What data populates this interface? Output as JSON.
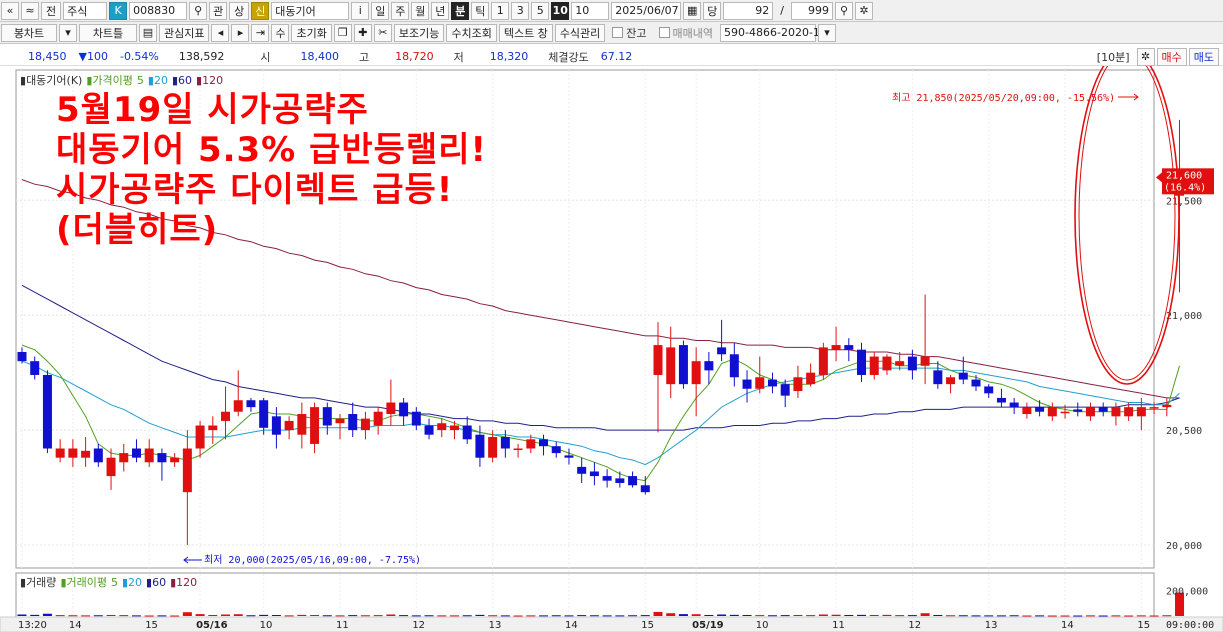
{
  "toolbar1": {
    "btn_prev": "«",
    "btn_up": "≈",
    "btn_jeon": "전",
    "type_select": "주식",
    "k_badge": "K",
    "code": "008830",
    "btn_gwan": "관",
    "btn_sang": "상",
    "sin_badge": "신",
    "name": "대동기어",
    "btn_info": "i",
    "periods": [
      "일",
      "주",
      "월",
      "년",
      "분",
      "틱"
    ],
    "active_period": "분",
    "intervals": [
      "1",
      "3",
      "5",
      "10"
    ],
    "active_interval": "10",
    "interval_select": "10",
    "date": "2025/06/07",
    "btn_dang": "당",
    "count": "92",
    "slash": "/",
    "max": "999"
  },
  "toolbar2": {
    "btn_bongchart": "봉차트",
    "btn_chartteul": "차트틀",
    "btn_gwansim": "관심지표",
    "btn_su": "수",
    "btn_chogihwa": "초기화",
    "btn_bojo": "보조기능",
    "btn_suchi": "수치조회",
    "btn_text": "텍스트 창",
    "btn_susik": "수식관리",
    "chk_jango": "잔고",
    "chk_maemae": "매매내역",
    "account": "590-4866-2020-1"
  },
  "quote": {
    "price": "18,450",
    "change": "▼100",
    "change_pct": "-0.54%",
    "volume": "138,592",
    "open_label": "시",
    "open": "18,400",
    "high_label": "고",
    "high": "18,720",
    "low_label": "저",
    "low": "18,320",
    "strength_label": "체결강도",
    "strength": "67.12",
    "btn_10bun": "[10분]",
    "btn_maesu": "매수",
    "btn_maedo": "매도"
  },
  "overlay": {
    "line1": "5월19일 시가공략주",
    "line2": "대동기어 5.3% 급반등랠리!",
    "line3": "시가공략주 다이렉트 급등!",
    "line4": "(더블히트)"
  },
  "chart_data": {
    "type": "candlestick",
    "legend_price": {
      "name": "대동기어(K)",
      "ma_label": "가격이평",
      "ma_periods": [
        "5",
        "20",
        "60",
        "120"
      ]
    },
    "legend_volume": {
      "name": "거래량",
      "ma_label": "거래이평",
      "ma_periods": [
        "5",
        "20",
        "60",
        "120"
      ]
    },
    "ylim": [
      19900,
      21980
    ],
    "yticks": [
      "21,500",
      "21,000",
      "20,500",
      "20,000"
    ],
    "ytick_values": [
      21500,
      21000,
      20500,
      20000
    ],
    "vol_ylim": [
      0,
      300000
    ],
    "vol_tick": "200,000",
    "vol_tick_value": 200000,
    "xticks": [
      {
        "i": 0,
        "label": "13:20"
      },
      {
        "i": 4,
        "label": "14"
      },
      {
        "i": 10,
        "label": "15"
      },
      {
        "i": 14,
        "label": "05/16"
      },
      {
        "i": 19,
        "label": "10"
      },
      {
        "i": 25,
        "label": "11"
      },
      {
        "i": 31,
        "label": "12"
      },
      {
        "i": 37,
        "label": "13"
      },
      {
        "i": 43,
        "label": "14"
      },
      {
        "i": 49,
        "label": "15"
      },
      {
        "i": 53,
        "label": "05/19"
      },
      {
        "i": 58,
        "label": "10"
      },
      {
        "i": 64,
        "label": "11"
      },
      {
        "i": 70,
        "label": "12"
      },
      {
        "i": 76,
        "label": "13"
      },
      {
        "i": 82,
        "label": "14"
      },
      {
        "i": 88,
        "label": "15"
      }
    ],
    "time_label": "09:00:00",
    "high_annotation": "최고 21,850(2025/05/20,09:00, -15.56%)",
    "low_annotation": "최저 20,000(2025/05/16,09:00, -7.75%)",
    "last_price_label": "21,600",
    "last_pct_label": "(16.4%)",
    "last_price": 21600,
    "colors": {
      "up": "#e01010",
      "down": "#1010d0",
      "ma5": "#50a020",
      "ma20": "#20a0d0",
      "ma60": "#20208a",
      "ma120": "#8a2040"
    },
    "candles": [
      {
        "o": 20840,
        "h": 20860,
        "l": 20790,
        "c": 20800,
        "v": 12000
      },
      {
        "o": 20800,
        "h": 20820,
        "l": 20720,
        "c": 20740,
        "v": 9000
      },
      {
        "o": 20740,
        "h": 20760,
        "l": 20400,
        "c": 20420,
        "v": 18000
      },
      {
        "o": 20380,
        "h": 20460,
        "l": 20360,
        "c": 20420,
        "v": 7000
      },
      {
        "o": 20380,
        "h": 20460,
        "l": 20340,
        "c": 20420,
        "v": 6000
      },
      {
        "o": 20380,
        "h": 20470,
        "l": 20340,
        "c": 20410,
        "v": 5000
      },
      {
        "o": 20420,
        "h": 20440,
        "l": 20340,
        "c": 20360,
        "v": 6000
      },
      {
        "o": 20300,
        "h": 20420,
        "l": 20240,
        "c": 20380,
        "v": 8000
      },
      {
        "o": 20360,
        "h": 20440,
        "l": 20320,
        "c": 20400,
        "v": 7000
      },
      {
        "o": 20420,
        "h": 20460,
        "l": 20360,
        "c": 20380,
        "v": 5000
      },
      {
        "o": 20360,
        "h": 20460,
        "l": 20340,
        "c": 20420,
        "v": 4000
      },
      {
        "o": 20400,
        "h": 20420,
        "l": 20280,
        "c": 20360,
        "v": 5000
      },
      {
        "o": 20360,
        "h": 20400,
        "l": 20340,
        "c": 20380,
        "v": 4000
      },
      {
        "o": 20230,
        "h": 20500,
        "l": 20000,
        "c": 20420,
        "v": 30000
      },
      {
        "o": 20420,
        "h": 20540,
        "l": 20380,
        "c": 20520,
        "v": 15000
      },
      {
        "o": 20500,
        "h": 20560,
        "l": 20440,
        "c": 20520,
        "v": 8000
      },
      {
        "o": 20540,
        "h": 20690,
        "l": 20460,
        "c": 20580,
        "v": 12000
      },
      {
        "o": 20580,
        "h": 20760,
        "l": 20560,
        "c": 20630,
        "v": 14000
      },
      {
        "o": 20630,
        "h": 20640,
        "l": 20580,
        "c": 20600,
        "v": 6000
      },
      {
        "o": 20630,
        "h": 20640,
        "l": 20480,
        "c": 20510,
        "v": 9000
      },
      {
        "o": 20560,
        "h": 20600,
        "l": 20420,
        "c": 20480,
        "v": 8000
      },
      {
        "o": 20500,
        "h": 20560,
        "l": 20460,
        "c": 20540,
        "v": 5000
      },
      {
        "o": 20480,
        "h": 20620,
        "l": 20420,
        "c": 20570,
        "v": 9000
      },
      {
        "o": 20440,
        "h": 20620,
        "l": 20400,
        "c": 20600,
        "v": 8000
      },
      {
        "o": 20600,
        "h": 20620,
        "l": 20480,
        "c": 20520,
        "v": 6000
      },
      {
        "o": 20530,
        "h": 20570,
        "l": 20460,
        "c": 20550,
        "v": 5000
      },
      {
        "o": 20570,
        "h": 20620,
        "l": 20470,
        "c": 20500,
        "v": 7000
      },
      {
        "o": 20500,
        "h": 20580,
        "l": 20460,
        "c": 20550,
        "v": 6000
      },
      {
        "o": 20520,
        "h": 20600,
        "l": 20480,
        "c": 20580,
        "v": 7000
      },
      {
        "o": 20570,
        "h": 20720,
        "l": 20520,
        "c": 20620,
        "v": 12000
      },
      {
        "o": 20620,
        "h": 20640,
        "l": 20520,
        "c": 20560,
        "v": 7000
      },
      {
        "o": 20580,
        "h": 20600,
        "l": 20500,
        "c": 20520,
        "v": 5000
      },
      {
        "o": 20520,
        "h": 20550,
        "l": 20460,
        "c": 20480,
        "v": 6000
      },
      {
        "o": 20500,
        "h": 20550,
        "l": 20470,
        "c": 20530,
        "v": 5000
      },
      {
        "o": 20500,
        "h": 20540,
        "l": 20460,
        "c": 20520,
        "v": 5000
      },
      {
        "o": 20520,
        "h": 20560,
        "l": 20440,
        "c": 20460,
        "v": 6000
      },
      {
        "o": 20480,
        "h": 20520,
        "l": 20340,
        "c": 20380,
        "v": 9000
      },
      {
        "o": 20380,
        "h": 20500,
        "l": 20360,
        "c": 20470,
        "v": 6000
      },
      {
        "o": 20470,
        "h": 20500,
        "l": 20380,
        "c": 20420,
        "v": 5000
      },
      {
        "o": 20420,
        "h": 20440,
        "l": 20380,
        "c": 20420,
        "v": 4000
      },
      {
        "o": 20420,
        "h": 20480,
        "l": 20400,
        "c": 20460,
        "v": 5000
      },
      {
        "o": 20460,
        "h": 20480,
        "l": 20390,
        "c": 20430,
        "v": 5000
      },
      {
        "o": 20430,
        "h": 20450,
        "l": 20380,
        "c": 20400,
        "v": 6000
      },
      {
        "o": 20390,
        "h": 20420,
        "l": 20350,
        "c": 20380,
        "v": 5000
      },
      {
        "o": 20340,
        "h": 20380,
        "l": 20270,
        "c": 20310,
        "v": 7000
      },
      {
        "o": 20320,
        "h": 20360,
        "l": 20260,
        "c": 20300,
        "v": 6000
      },
      {
        "o": 20300,
        "h": 20330,
        "l": 20250,
        "c": 20280,
        "v": 5000
      },
      {
        "o": 20290,
        "h": 20320,
        "l": 20250,
        "c": 20270,
        "v": 5000
      },
      {
        "o": 20300,
        "h": 20320,
        "l": 20250,
        "c": 20260,
        "v": 6000
      },
      {
        "o": 20260,
        "h": 20300,
        "l": 20220,
        "c": 20230,
        "v": 7000
      },
      {
        "o": 20740,
        "h": 20970,
        "l": 20490,
        "c": 20870,
        "v": 32000
      },
      {
        "o": 20700,
        "h": 20950,
        "l": 20640,
        "c": 20860,
        "v": 22000
      },
      {
        "o": 20870,
        "h": 20890,
        "l": 20680,
        "c": 20700,
        "v": 15000
      },
      {
        "o": 20700,
        "h": 20860,
        "l": 20560,
        "c": 20800,
        "v": 14000
      },
      {
        "o": 20800,
        "h": 20840,
        "l": 20700,
        "c": 20760,
        "v": 8000
      },
      {
        "o": 20860,
        "h": 20980,
        "l": 20800,
        "c": 20830,
        "v": 12000
      },
      {
        "o": 20830,
        "h": 20880,
        "l": 20690,
        "c": 20730,
        "v": 9000
      },
      {
        "o": 20720,
        "h": 20760,
        "l": 20620,
        "c": 20680,
        "v": 8000
      },
      {
        "o": 20680,
        "h": 20820,
        "l": 20660,
        "c": 20730,
        "v": 7000
      },
      {
        "o": 20720,
        "h": 20750,
        "l": 20660,
        "c": 20690,
        "v": 6000
      },
      {
        "o": 20700,
        "h": 20720,
        "l": 20600,
        "c": 20650,
        "v": 7000
      },
      {
        "o": 20670,
        "h": 20780,
        "l": 20640,
        "c": 20730,
        "v": 8000
      },
      {
        "o": 20700,
        "h": 20790,
        "l": 20690,
        "c": 20750,
        "v": 7000
      },
      {
        "o": 20740,
        "h": 20880,
        "l": 20720,
        "c": 20860,
        "v": 12000
      },
      {
        "o": 20850,
        "h": 20950,
        "l": 20800,
        "c": 20870,
        "v": 10000
      },
      {
        "o": 20870,
        "h": 20900,
        "l": 20800,
        "c": 20850,
        "v": 8000
      },
      {
        "o": 20850,
        "h": 20880,
        "l": 20710,
        "c": 20740,
        "v": 9000
      },
      {
        "o": 20740,
        "h": 20840,
        "l": 20720,
        "c": 20820,
        "v": 8000
      },
      {
        "o": 20760,
        "h": 20830,
        "l": 20740,
        "c": 20820,
        "v": 9000
      },
      {
        "o": 20780,
        "h": 20840,
        "l": 20760,
        "c": 20800,
        "v": 7000
      },
      {
        "o": 20820,
        "h": 20850,
        "l": 20720,
        "c": 20760,
        "v": 7000
      },
      {
        "o": 20780,
        "h": 21090,
        "l": 20700,
        "c": 20820,
        "v": 22000
      },
      {
        "o": 20760,
        "h": 20800,
        "l": 20680,
        "c": 20700,
        "v": 8000
      },
      {
        "o": 20700,
        "h": 20740,
        "l": 20660,
        "c": 20730,
        "v": 6000
      },
      {
        "o": 20750,
        "h": 20820,
        "l": 20700,
        "c": 20720,
        "v": 6000
      },
      {
        "o": 20720,
        "h": 20740,
        "l": 20670,
        "c": 20690,
        "v": 5000
      },
      {
        "o": 20690,
        "h": 20700,
        "l": 20640,
        "c": 20660,
        "v": 5000
      },
      {
        "o": 20640,
        "h": 20680,
        "l": 20600,
        "c": 20620,
        "v": 5000
      },
      {
        "o": 20620,
        "h": 20640,
        "l": 20570,
        "c": 20600,
        "v": 6000
      },
      {
        "o": 20570,
        "h": 20620,
        "l": 20550,
        "c": 20600,
        "v": 4000
      },
      {
        "o": 20600,
        "h": 20630,
        "l": 20560,
        "c": 20580,
        "v": 5000
      },
      {
        "o": 20560,
        "h": 20620,
        "l": 20540,
        "c": 20600,
        "v": 4000
      },
      {
        "o": 20580,
        "h": 20610,
        "l": 20550,
        "c": 20580,
        "v": 4000
      },
      {
        "o": 20590,
        "h": 20620,
        "l": 20560,
        "c": 20580,
        "v": 4000
      },
      {
        "o": 20560,
        "h": 20620,
        "l": 20540,
        "c": 20600,
        "v": 5000
      },
      {
        "o": 20600,
        "h": 20620,
        "l": 20560,
        "c": 20580,
        "v": 4000
      },
      {
        "o": 20560,
        "h": 20620,
        "l": 20520,
        "c": 20600,
        "v": 5000
      },
      {
        "o": 20560,
        "h": 20620,
        "l": 20540,
        "c": 20600,
        "v": 4000
      },
      {
        "o": 20560,
        "h": 20640,
        "l": 20500,
        "c": 20600,
        "v": 5000
      },
      {
        "o": 20600,
        "h": 20620,
        "l": 20570,
        "c": 20600,
        "v": 4000
      },
      {
        "o": 20600,
        "h": 20640,
        "l": 20560,
        "c": 20610,
        "v": 6000
      },
      {
        "o": 21520,
        "h": 21850,
        "l": 21100,
        "c": 21600,
        "v": 185000
      }
    ],
    "ma5": [
      20870,
      20850,
      20800,
      20740,
      20650,
      20560,
      20440,
      20400,
      20390,
      20390,
      20400,
      20390,
      20380,
      20370,
      20390,
      20430,
      20470,
      20520,
      20570,
      20580,
      20570,
      20570,
      20560,
      20550,
      20550,
      20550,
      20550,
      20540,
      20540,
      20560,
      20570,
      20570,
      20560,
      20550,
      20530,
      20510,
      20490,
      20480,
      20470,
      20460,
      20450,
      20440,
      20420,
      20400,
      20380,
      20360,
      20340,
      20310,
      20290,
      20280,
      20360,
      20470,
      20560,
      20640,
      20700,
      20790,
      20810,
      20780,
      20740,
      20720,
      20700,
      20700,
      20700,
      20720,
      20760,
      20780,
      20800,
      20800,
      20800,
      20780,
      20780,
      20790,
      20790,
      20760,
      20740,
      20730,
      20710,
      20700,
      20680,
      20650,
      20620,
      20600,
      20590,
      20580,
      20580,
      20580,
      20580,
      20580,
      20590,
      20590,
      20590,
      20780
    ],
    "ma20": [
      20800,
      20780,
      20750,
      20730,
      20700,
      20670,
      20640,
      20610,
      20590,
      20560,
      20530,
      20510,
      20490,
      20470,
      20470,
      20470,
      20470,
      20480,
      20490,
      20500,
      20500,
      20500,
      20510,
      20510,
      20510,
      20510,
      20510,
      20510,
      20520,
      20520,
      20520,
      20530,
      20520,
      20520,
      20510,
      20500,
      20490,
      20480,
      20480,
      20470,
      20470,
      20460,
      20450,
      20440,
      20430,
      20410,
      20400,
      20380,
      20370,
      20350,
      20380,
      20420,
      20460,
      20500,
      20550,
      20600,
      20630,
      20660,
      20680,
      20700,
      20710,
      20720,
      20730,
      20740,
      20750,
      20760,
      20770,
      20770,
      20770,
      20770,
      20770,
      20770,
      20770,
      20760,
      20760,
      20750,
      20740,
      20730,
      20720,
      20710,
      20690,
      20680,
      20670,
      20660,
      20650,
      20640,
      20630,
      20620,
      20620,
      20610,
      20610,
      20660
    ],
    "ma60": [
      21130,
      21100,
      21070,
      21040,
      21010,
      20980,
      20950,
      20920,
      20890,
      20860,
      20830,
      20800,
      20780,
      20760,
      20740,
      20720,
      20710,
      20690,
      20680,
      20670,
      20660,
      20650,
      20640,
      20640,
      20630,
      20620,
      20610,
      20600,
      20600,
      20590,
      20580,
      20570,
      20570,
      20560,
      20550,
      20550,
      20540,
      20540,
      20530,
      20530,
      20520,
      20520,
      20510,
      20510,
      20510,
      20510,
      20500,
      20500,
      20500,
      20500,
      20500,
      20500,
      20500,
      20510,
      20510,
      20510,
      20520,
      20520,
      20520,
      20530,
      20530,
      20540,
      20540,
      20550,
      20550,
      20560,
      20560,
      20570,
      20570,
      20580,
      20580,
      20590,
      20590,
      20590,
      20600,
      20600,
      20600,
      20600,
      20600,
      20600,
      20600,
      20600,
      20600,
      20600,
      20600,
      20600,
      20600,
      20610,
      20610,
      20610,
      20620,
      20640
    ],
    "ma120": [
      21590,
      21570,
      21560,
      21540,
      21530,
      21510,
      21500,
      21480,
      21470,
      21450,
      21440,
      21420,
      21410,
      21390,
      21380,
      21360,
      21350,
      21330,
      21320,
      21300,
      21290,
      21270,
      21260,
      21240,
      21230,
      21210,
      21200,
      21180,
      21170,
      21150,
      21140,
      21120,
      21110,
      21090,
      21080,
      21070,
      21050,
      21040,
      21020,
      21010,
      21000,
      20990,
      20980,
      20970,
      20960,
      20950,
      20940,
      20930,
      20920,
      20910,
      20910,
      20900,
      20900,
      20890,
      20890,
      20880,
      20880,
      20870,
      20870,
      20870,
      20860,
      20860,
      20860,
      20850,
      20850,
      20850,
      20840,
      20840,
      20840,
      20830,
      20830,
      20820,
      20820,
      20810,
      20800,
      20790,
      20780,
      20770,
      20760,
      20750,
      20740,
      20730,
      20720,
      20710,
      20700,
      20690,
      20680,
      20670,
      20660,
      20650,
      20640,
      20640
    ]
  }
}
